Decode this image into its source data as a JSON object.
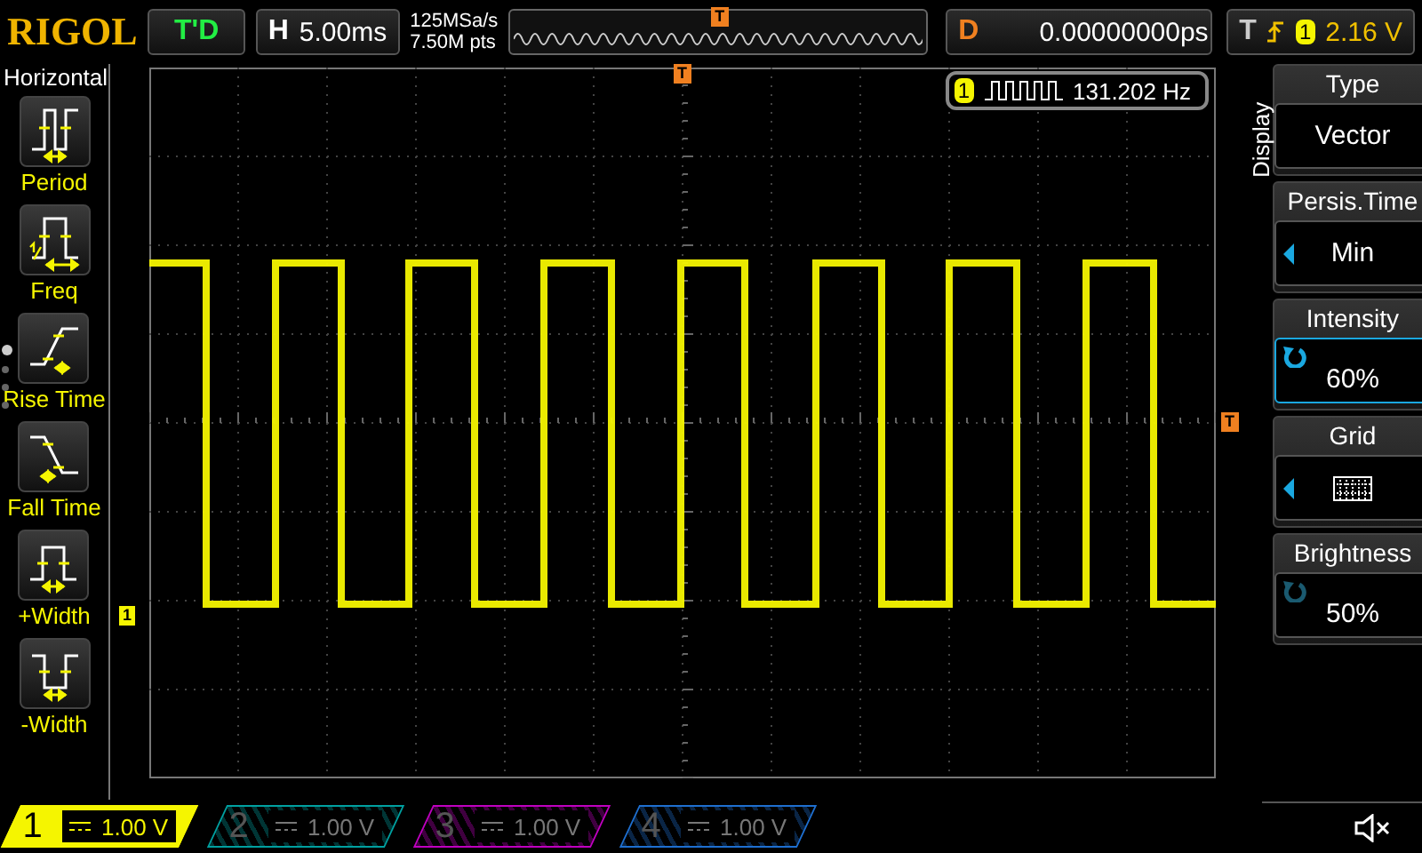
{
  "top_bar": {
    "brand": "RIGOL",
    "run_state": "T'D",
    "horizontal": {
      "label": "H",
      "timebase": "5.00ms"
    },
    "sample_rate": "125MSa/s",
    "memory_depth": "7.50M pts",
    "delay": {
      "label": "D",
      "value": "0.00000000ps"
    },
    "trigger": {
      "label": "T",
      "source": "1",
      "level": "2.16 V"
    }
  },
  "left_menu": {
    "title": "Horizontal",
    "items": [
      {
        "kind": "period",
        "label": "Period"
      },
      {
        "kind": "freq",
        "label": "Freq"
      },
      {
        "kind": "rise",
        "label": "Rise Time"
      },
      {
        "kind": "fall",
        "label": "Fall Time"
      },
      {
        "kind": "pwidth",
        "label": "+Width"
      },
      {
        "kind": "nwidth",
        "label": "-Width"
      }
    ],
    "pages": [
      {
        "selected": true
      },
      {
        "selected": false
      },
      {
        "selected": false
      },
      {
        "selected": false
      }
    ]
  },
  "screen": {
    "overview_trigger_marker": "T",
    "trigger_position_marker": "T",
    "trigger_level_marker": "T",
    "channel_marker": "1",
    "measurement": {
      "channel": "1",
      "value": "131.202 Hz"
    }
  },
  "right_menu": {
    "title": "Display",
    "items": [
      {
        "kind": "text",
        "label": "Type",
        "value": "Vector"
      },
      {
        "kind": "choice",
        "label": "Persis.Time",
        "value": "Min"
      },
      {
        "kind": "knob",
        "label": "Intensity",
        "value": "60%",
        "selected": true
      },
      {
        "kind": "grid",
        "label": "Grid"
      },
      {
        "kind": "knob",
        "label": "Brightness",
        "value": "50%",
        "selected": false
      }
    ]
  },
  "channels": [
    {
      "number": "1",
      "scale": "1.00 V",
      "on": true,
      "color": "#f5f500"
    },
    {
      "number": "2",
      "scale": "1.00 V",
      "on": false,
      "color": "#00a0a0"
    },
    {
      "number": "3",
      "scale": "1.00 V",
      "on": false,
      "color": "#c000c0"
    },
    {
      "number": "4",
      "scale": "1.00 V",
      "on": false,
      "color": "#1e6fd0"
    }
  ],
  "sound": {
    "muted": true
  }
}
